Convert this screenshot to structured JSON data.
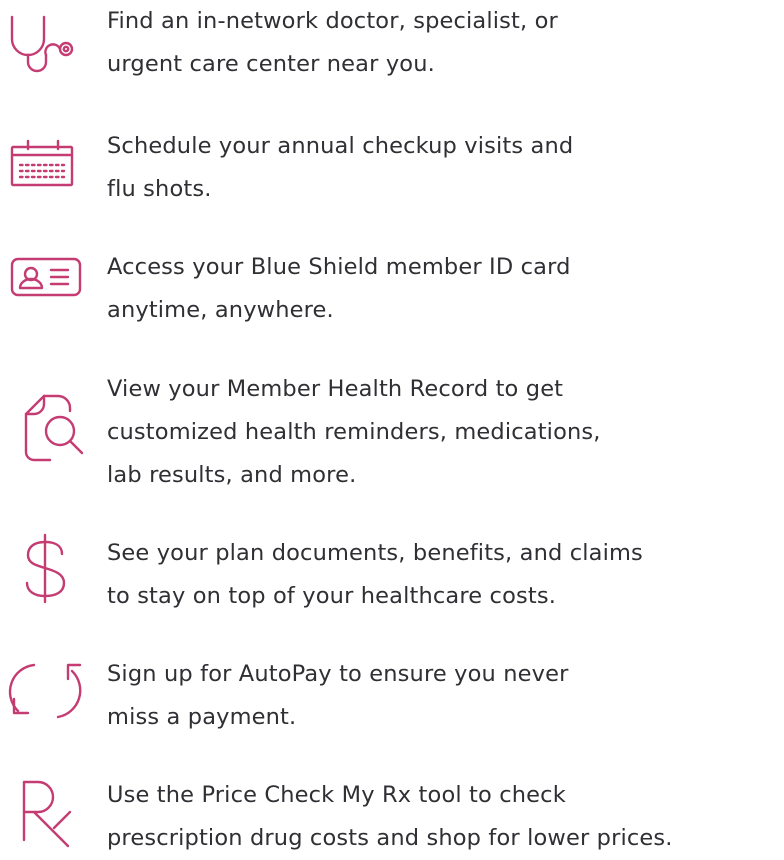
{
  "items": [
    {
      "icon": "stethoscope-icon",
      "lines": [
        "Find an in-network doctor, specialist, or",
        "urgent care center near you."
      ]
    },
    {
      "icon": "calendar-icon",
      "lines": [
        "Schedule your annual checkup visits and",
        "flu shots."
      ]
    },
    {
      "icon": "id-card-icon",
      "lines": [
        "Access your Blue Shield member ID card",
        "anytime, anywhere."
      ]
    },
    {
      "icon": "document-search-icon",
      "lines": [
        "View your Member Health Record to get",
        "customized health reminders, medications,",
        "lab results, and more."
      ]
    },
    {
      "icon": "dollar-sign-icon",
      "lines": [
        "See your plan documents, benefits, and claims",
        "to stay on top of your healthcare costs."
      ]
    },
    {
      "icon": "refresh-cycle-icon",
      "lines": [
        "Sign up for AutoPay to ensure you never",
        "miss a payment."
      ]
    },
    {
      "icon": "rx-prescription-icon",
      "lines": [
        "Use the Price Check My Rx tool to check",
        "prescription drug costs and shop for lower prices."
      ]
    }
  ],
  "colors": {
    "icon": "#c43c72",
    "text": "#2f2f34",
    "background": "#ffffff"
  }
}
